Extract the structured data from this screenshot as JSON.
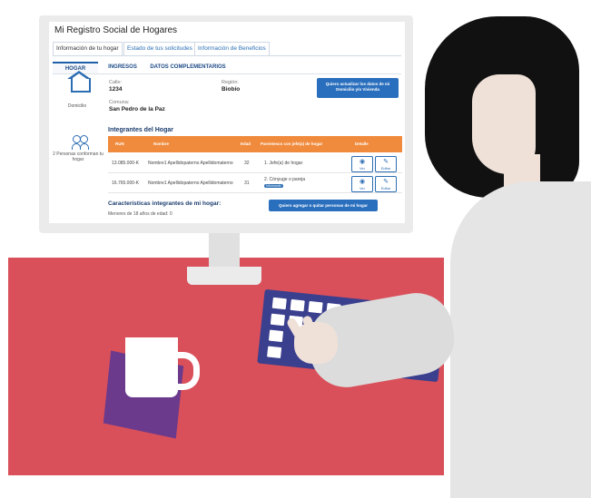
{
  "app": {
    "title": "Mi Registro Social de Hogares",
    "tabs": [
      "Información de tu hogar",
      "Estado de tus solicitudes",
      "Información de Beneficios"
    ],
    "subtabs": [
      "HOGAR",
      "INGRESOS",
      "DATOS COMPLEMENTARIOS"
    ],
    "domicilio_label": "Domicilio",
    "calle_label": "Calle:",
    "calle_value": "1234",
    "region_label": "Región:",
    "region_value": "Biobío",
    "comuna_label": "Comuna:",
    "comuna_value": "San Pedro de la Paz",
    "actualizar_button": "Quiero actualizar los datos de mi Domicilio y/o Vivienda",
    "personas_label": "2 Personas conforman tu hogar",
    "integrantes_title": "Integrantes del Hogar",
    "table_headers": [
      "RUN",
      "Nombre",
      "Edad",
      "Parentesco con jefe(a) de hogar",
      "Detalle"
    ],
    "rows": [
      {
        "run": "13.085.000-K",
        "nombre": "Nombre1 Apellidopaterno Apellidomaterno",
        "edad": "32",
        "parentesco": "1. Jefe(a) de hogar",
        "badge": ""
      },
      {
        "run": "16.765.000-K",
        "nombre": "Nombre1 Apellidopaterno Apellidomaterno",
        "edad": "31",
        "parentesco": "2. Cónyuge o pareja",
        "badge": "Informante"
      }
    ],
    "ver_label": "Ver",
    "editar_label": "Editar",
    "carac_title": "Características integrantes de mi hogar:",
    "carac_sub": "Menores de 18 años de edad: 0",
    "agregar_button": "Quiero agregar o quitar personas de mi hogar"
  },
  "colors": {
    "desk": "#d9505a",
    "table_header": "#f08a3c",
    "primary_blue": "#2a6fbd",
    "keyboard": "#3a3f8e",
    "mug_mat": "#6b3a8c"
  }
}
